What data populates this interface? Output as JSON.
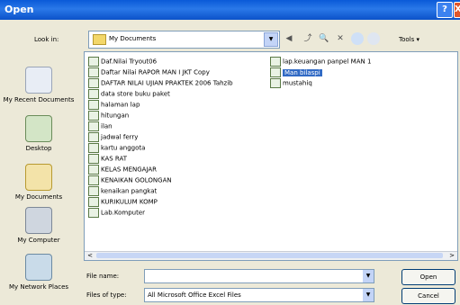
{
  "window": {
    "title": "Open",
    "help_btn": "?",
    "close_btn": "X"
  },
  "toolbar": {
    "look_in_label": "Look in:",
    "look_in_value": "My Documents",
    "drop": "▼",
    "back": "◀",
    "up": "⤴",
    "search": "🔍",
    "delete": "✕",
    "tools_label": "Tools ▾"
  },
  "places": [
    {
      "label": "My Recent Documents",
      "icon": "recent-docs-icon"
    },
    {
      "label": "Desktop",
      "icon": "desktop-icon"
    },
    {
      "label": "My Documents",
      "icon": "my-documents-icon"
    },
    {
      "label": "My Computer",
      "icon": "my-computer-icon"
    },
    {
      "label": "My Network Places",
      "icon": "network-places-icon"
    }
  ],
  "files": [
    "Daf.Nilai Tryout06",
    "Daftar Nilai RAPOR MAN I JKT Copy",
    "DAFTAR NILAI UJIAN PRAKTEK 2006 Tahzib",
    "data store buku paket",
    "halaman lap",
    "hitungan",
    "ilan",
    "jadwal ferry",
    "kartu anggota",
    "KAS RAT",
    "KELAS MENGAJAR",
    "KENAIKAN GOLONGAN",
    "kenaikan pangkat",
    "KURIKULUM KOMP",
    "Lab.Komputer",
    "lap.keuangan panpel MAN 1",
    "Man bilaspi",
    "mustahiq"
  ],
  "scroll": {
    "left": "<",
    "right": ">"
  },
  "bottom": {
    "file_name_label": "File name:",
    "file_name_value": "",
    "files_of_type_label": "Files of type:",
    "files_of_type_value": "All Microsoft Office Excel Files",
    "open_label": "Open",
    "cancel_label": "Cancel"
  }
}
